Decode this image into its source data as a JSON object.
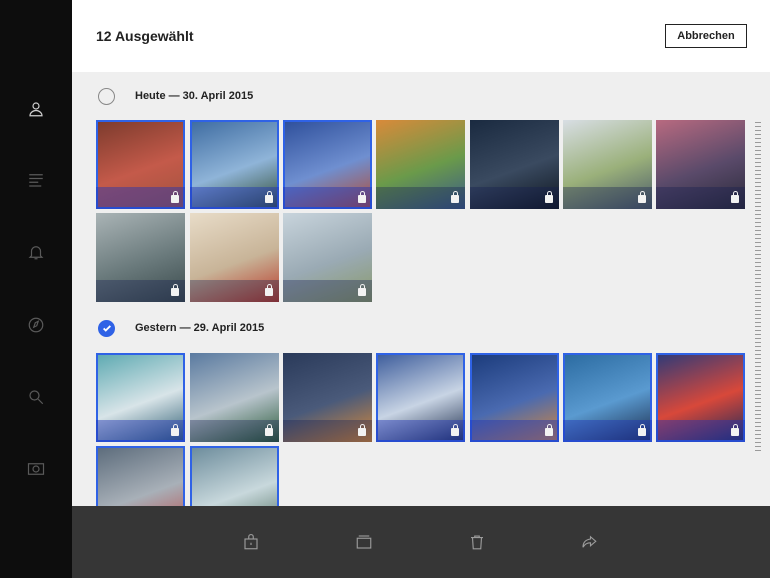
{
  "header": {
    "title": "12 Ausgewählt",
    "cancel_label": "Abbrechen"
  },
  "sidebar": {
    "items": [
      {
        "icon": "person-icon",
        "active": true
      },
      {
        "icon": "feed-icon",
        "active": false
      },
      {
        "icon": "bell-icon",
        "active": false
      },
      {
        "icon": "compass-icon",
        "active": false
      },
      {
        "icon": "search-icon",
        "active": false
      },
      {
        "icon": "camera-icon",
        "active": false
      }
    ]
  },
  "sections": [
    {
      "label": "Heute — 30. April 2015",
      "checked": false,
      "photos": [
        {
          "selected": true,
          "colors": [
            "#7a3a2c",
            "#c45a4a",
            "#a0523e"
          ]
        },
        {
          "selected": true,
          "colors": [
            "#3c6aa0",
            "#8fb4d8",
            "#2e4a30"
          ]
        },
        {
          "selected": true,
          "colors": [
            "#2d4e9a",
            "#6f8fd0",
            "#b5482e"
          ]
        },
        {
          "selected": false,
          "colors": [
            "#d98a3a",
            "#6a9a4a",
            "#3a5a8a"
          ]
        },
        {
          "selected": false,
          "colors": [
            "#1a2a40",
            "#3a4a60",
            "#0e1620"
          ]
        },
        {
          "selected": false,
          "colors": [
            "#d8dee4",
            "#9ab07a",
            "#4a5a6a"
          ]
        },
        {
          "selected": false,
          "colors": [
            "#b86a80",
            "#5a4a6a",
            "#2a2a3a"
          ]
        },
        {
          "selected": false,
          "colors": [
            "#aab4b6",
            "#6a7a7c",
            "#3a4a4c"
          ]
        },
        {
          "selected": false,
          "colors": [
            "#e8dcc8",
            "#c8b498",
            "#b83a2a"
          ]
        },
        {
          "selected": false,
          "colors": [
            "#c8d4dc",
            "#9aaab4",
            "#8a9a6a"
          ]
        }
      ]
    },
    {
      "label": "Gestern — 29. April 2015",
      "checked": true,
      "photos": [
        {
          "selected": true,
          "colors": [
            "#5aa8b0",
            "#d8e4e8",
            "#2a5a70"
          ]
        },
        {
          "selected": false,
          "colors": [
            "#5a7aa0",
            "#b8c4cc",
            "#2a5a3a"
          ]
        },
        {
          "selected": false,
          "colors": [
            "#2a3a5a",
            "#4a5a7a",
            "#d88a3a"
          ]
        },
        {
          "selected": true,
          "colors": [
            "#3a5a9a",
            "#c8d4e4",
            "#1a2a4a"
          ]
        },
        {
          "selected": true,
          "colors": [
            "#1a3a7a",
            "#4a6ab0",
            "#d8883a"
          ]
        },
        {
          "selected": true,
          "colors": [
            "#2a6aa0",
            "#5a9ad0",
            "#1a2a4a"
          ]
        },
        {
          "selected": true,
          "colors": [
            "#2a3a7a",
            "#d8483a",
            "#1a2a5a"
          ]
        },
        {
          "selected": true,
          "colors": [
            "#5a6a7a",
            "#a8b0b8",
            "#b84a4a"
          ]
        },
        {
          "selected": true,
          "colors": [
            "#6a8a9a",
            "#c8d8dc",
            "#4a6a5a"
          ]
        }
      ]
    }
  ],
  "toolbar": {
    "buttons": [
      {
        "icon": "lock-icon"
      },
      {
        "icon": "album-icon"
      },
      {
        "icon": "trash-icon"
      },
      {
        "icon": "share-icon"
      }
    ]
  },
  "colors": {
    "accent": "#2f62e6",
    "sidebar": "#0d0d0d",
    "toolbar": "#2a2a2a",
    "background": "#efefef"
  }
}
